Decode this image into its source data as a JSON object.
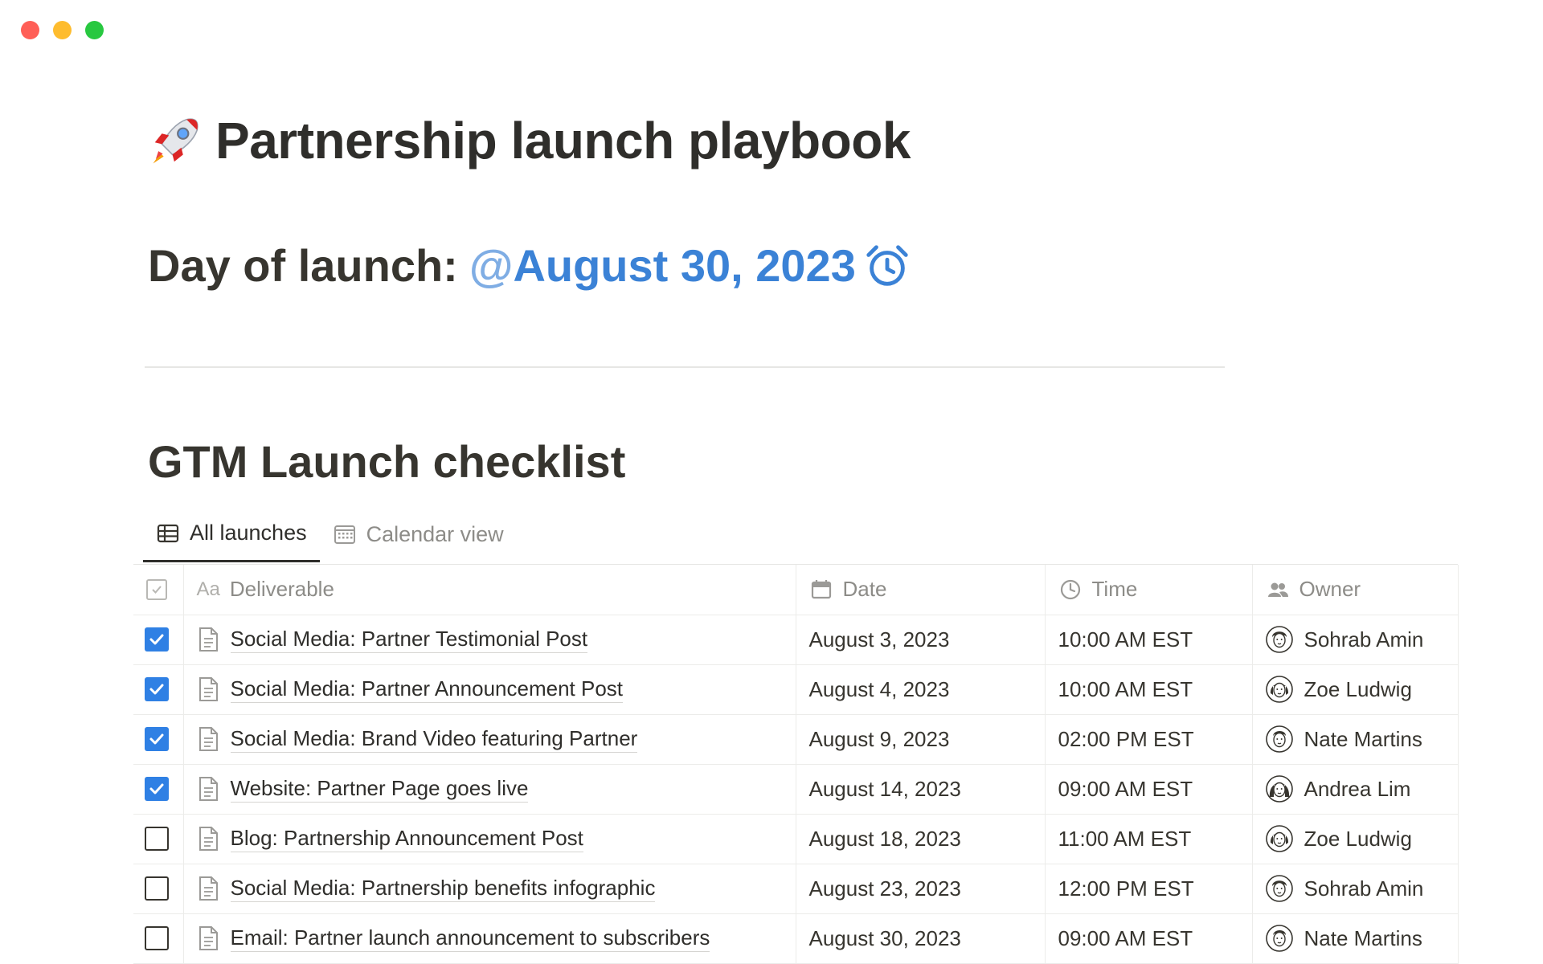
{
  "window": {
    "controls": [
      "close",
      "minimize",
      "zoom"
    ]
  },
  "page": {
    "icon": "rocket-icon",
    "title": "Partnership launch playbook"
  },
  "launch": {
    "label": "Day of launch:",
    "mention_at": "@",
    "mention_date": "August 30, 2023",
    "reminder_icon": "alarm-clock-icon",
    "mention_color": "#3b82d6"
  },
  "checklist": {
    "title": "GTM Launch checklist",
    "views": [
      {
        "label": "All launches",
        "icon": "table-icon",
        "active": true
      },
      {
        "label": "Calendar view",
        "icon": "calendar-grid-icon",
        "active": false
      }
    ],
    "columns": {
      "deliverable_prefix": "Aa",
      "deliverable": "Deliverable",
      "date": "Date",
      "time": "Time",
      "owner": "Owner"
    },
    "checkbox_color": "#2f80e4",
    "rows": [
      {
        "done": true,
        "deliverable": "Social Media: Partner Testimonial Post",
        "date": "August 3, 2023",
        "time": "10:00 AM EST",
        "owner": "Sohrab Amin"
      },
      {
        "done": true,
        "deliverable": "Social Media: Partner Announcement Post",
        "date": "August 4, 2023",
        "time": "10:00 AM EST",
        "owner": "Zoe Ludwig"
      },
      {
        "done": true,
        "deliverable": "Social Media: Brand Video featuring Partner",
        "date": "August 9, 2023",
        "time": "02:00 PM EST",
        "owner": "Nate Martins"
      },
      {
        "done": true,
        "deliverable": "Website: Partner Page goes live",
        "date": "August 14, 2023",
        "time": "09:00 AM EST",
        "owner": "Andrea Lim"
      },
      {
        "done": false,
        "deliverable": "Blog: Partnership Announcement Post",
        "date": "August 18, 2023",
        "time": "11:00 AM EST",
        "owner": "Zoe Ludwig"
      },
      {
        "done": false,
        "deliverable": "Social Media: Partnership benefits infographic",
        "date": "August 23, 2023",
        "time": "12:00 PM EST",
        "owner": "Sohrab Amin"
      },
      {
        "done": false,
        "deliverable": "Email: Partner launch announcement to subscribers",
        "date": "August 30, 2023",
        "time": "09:00 AM EST",
        "owner": "Nate Martins"
      }
    ]
  }
}
